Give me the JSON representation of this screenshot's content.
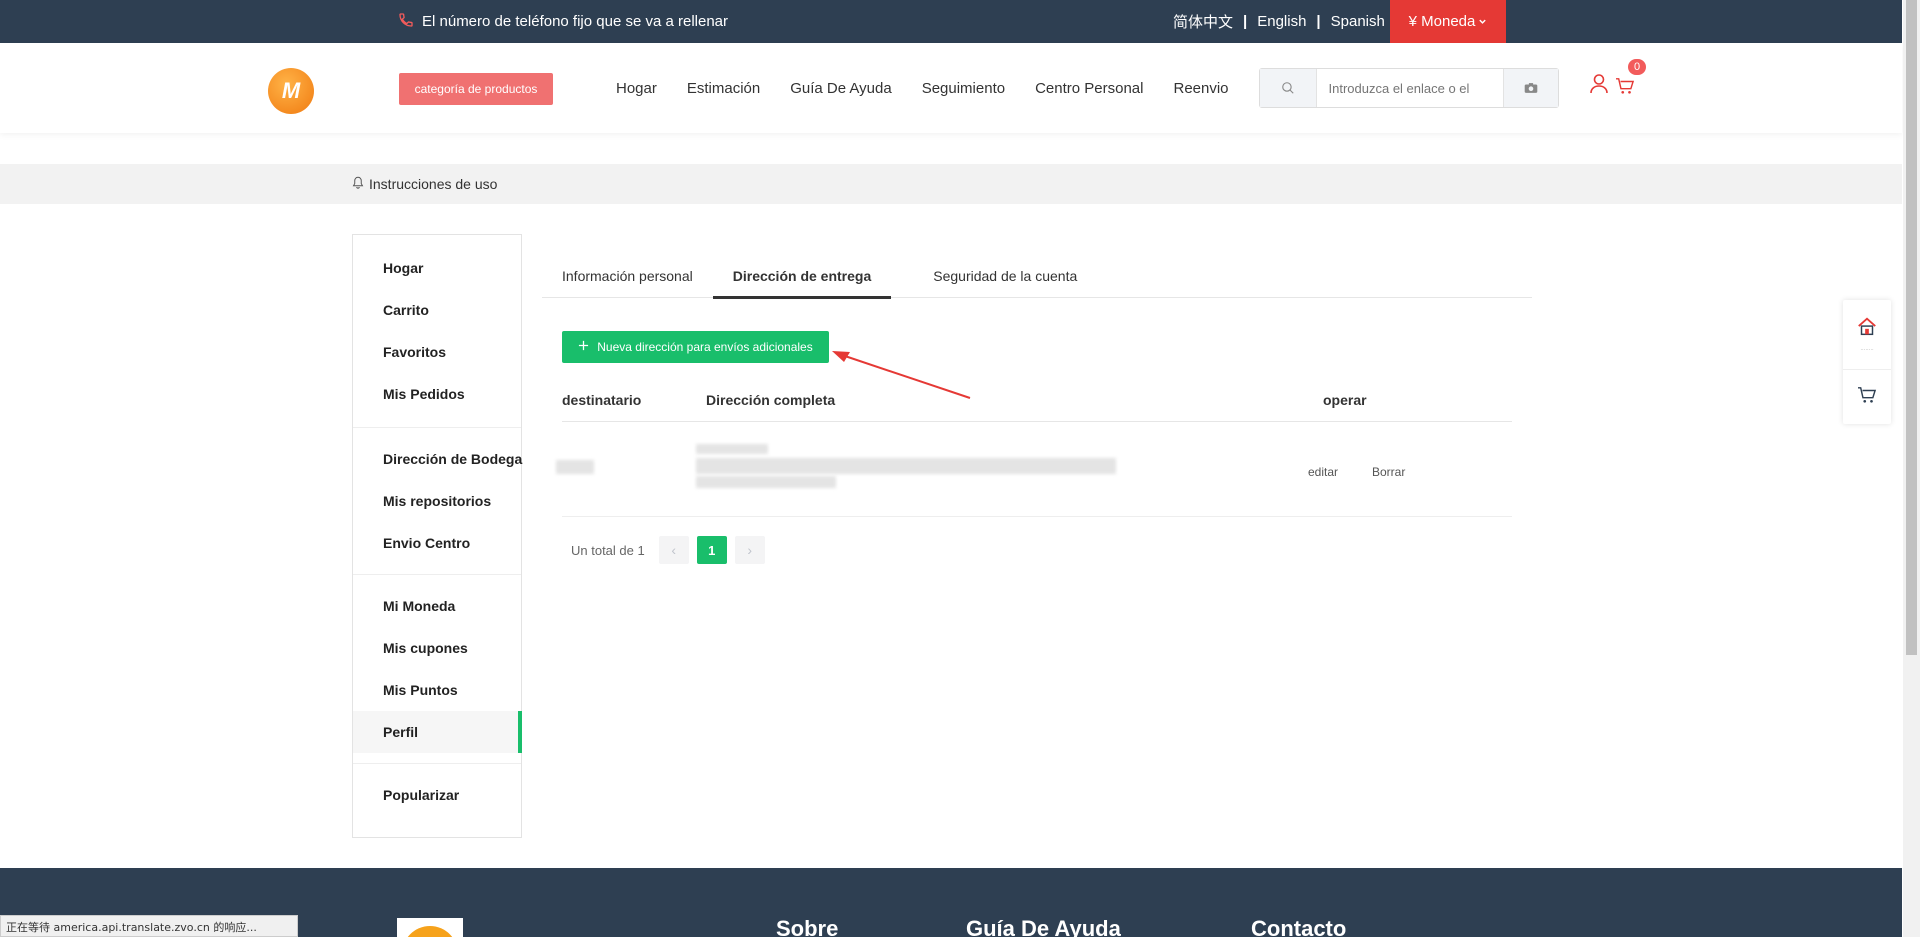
{
  "topbar": {
    "phone_text": "El número de teléfono fijo que se va a rellenar",
    "lang_zh": "简体中文",
    "lang_en": "English",
    "lang_es": "Spanish",
    "separator": "|",
    "currency_label": "¥ Moneda"
  },
  "header": {
    "logo_letter": "M",
    "category_button": "categoría de productos",
    "nav": [
      "Hogar",
      "Estimación",
      "Guía De Ayuda",
      "Seguimiento",
      "Centro Personal",
      "Reenvio"
    ],
    "search_placeholder": "Introduzca el enlace o el",
    "cart_count": "0"
  },
  "notice": {
    "text": "Instrucciones de uso"
  },
  "sidebar": {
    "group1": [
      "Hogar",
      "Carrito",
      "Favoritos",
      "Mis Pedidos"
    ],
    "group2": [
      "Dirección de Bodega",
      "Mis repositorios",
      "Envio Centro"
    ],
    "group3": [
      "Mi Moneda",
      "Mis cupones",
      "Mis Puntos",
      "Perfil"
    ],
    "group4": [
      "Popularizar"
    ]
  },
  "tabs": [
    "Información personal",
    "Dirección de entrega",
    "Seguridad de la cuenta"
  ],
  "add_button": "Nueva dirección para envíos adicionales",
  "table": {
    "headers": [
      "destinatario",
      "Dirección completa",
      "operar"
    ],
    "rows": [
      {
        "edit": "editar",
        "delete": "Borrar"
      }
    ]
  },
  "pager": {
    "total_label": "Un total de 1",
    "prev": "‹",
    "current": "1",
    "next": "›"
  },
  "footer": {
    "col1": "Sobre",
    "col2": "Guía De Ayuda",
    "col3": "Contacto"
  },
  "status_bar": "正在等待 america.api.translate.zvo.cn 的响应...",
  "colors": {
    "topbar": "#2e3f52",
    "currency": "#e53935",
    "green": "#19be6b",
    "category_button": "#f07171"
  }
}
